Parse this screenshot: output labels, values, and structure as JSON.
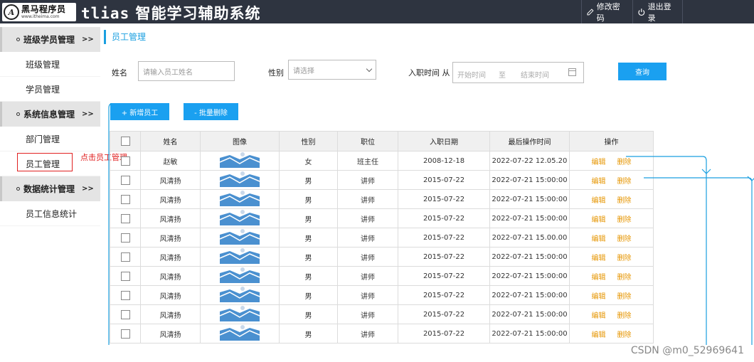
{
  "header": {
    "logo_cn": "黑马程序员",
    "logo_url": "www.itheima.com",
    "title_latin": "tlias",
    "title_cn": "智能学习辅助系统",
    "change_password": "修改密码",
    "logout": "退出登录"
  },
  "sidebar": {
    "groups": [
      {
        "label": "班级学员管理",
        "arrow": ">>",
        "items": [
          "班级管理",
          "学员管理"
        ]
      },
      {
        "label": "系统信息管理",
        "arrow": ">>",
        "items": [
          "部门管理",
          "员工管理"
        ]
      },
      {
        "label": "数据统计管理",
        "arrow": ">>",
        "items": [
          "员工信息统计"
        ]
      }
    ],
    "active_item": "员工管理"
  },
  "annotation": {
    "click_hint": "点击员工管理"
  },
  "page_title": "员工管理",
  "search": {
    "name_label": "姓名",
    "name_placeholder": "请输入员工姓名",
    "gender_label": "性别",
    "gender_placeholder": "请选择",
    "date_label": "入职时间 从",
    "date_start_placeholder": "开始时间",
    "date_sep": "至",
    "date_end_placeholder": "结束时间",
    "query_button": "查询"
  },
  "actions": {
    "add_button": "+ 新增员工",
    "batch_delete_button": "- 批量删除"
  },
  "table": {
    "columns": [
      "姓名",
      "图像",
      "性别",
      "职位",
      "入职日期",
      "最后操作时间",
      "操作"
    ],
    "edit_label": "编辑",
    "delete_label": "删除",
    "rows": [
      {
        "name": "赵敏",
        "gender": "女",
        "position": "班主任",
        "entry_date": "2008-12-18",
        "last_op": "2022-07-22 12.05.20"
      },
      {
        "name": "风清扬",
        "gender": "男",
        "position": "讲师",
        "entry_date": "2015-07-22",
        "last_op": "2022-07-21 15:00:00"
      },
      {
        "name": "风清扬",
        "gender": "男",
        "position": "讲师",
        "entry_date": "2015-07-22",
        "last_op": "2022-07-21 15:00:00"
      },
      {
        "name": "风清扬",
        "gender": "男",
        "position": "讲师",
        "entry_date": "2015-07-22",
        "last_op": "2022-07-21 15:00:00"
      },
      {
        "name": "风清扬",
        "gender": "男",
        "position": "讲师",
        "entry_date": "2015-07-22",
        "last_op": "2022-07-21 15.00.00"
      },
      {
        "name": "风清扬",
        "gender": "男",
        "position": "讲师",
        "entry_date": "2015-07-22",
        "last_op": "2022-07-21 15:00:00"
      },
      {
        "name": "风清扬",
        "gender": "男",
        "position": "讲师",
        "entry_date": "2015-07-22",
        "last_op": "2022-07-21 15:00:00"
      },
      {
        "name": "风清扬",
        "gender": "男",
        "position": "讲师",
        "entry_date": "2015-07-22",
        "last_op": "2022-07-21 15:00:00"
      },
      {
        "name": "风清扬",
        "gender": "男",
        "position": "讲师",
        "entry_date": "2015-07-22",
        "last_op": "2022-07-21 15:00:00"
      },
      {
        "name": "风清扬",
        "gender": "男",
        "position": "讲师",
        "entry_date": "2015-07-22",
        "last_op": "2022-07-21 15:00:00"
      }
    ]
  },
  "watermark": "CSDN @m0_52969641",
  "colors": {
    "header_bg": "#2e3440",
    "accent": "#1aa0f0",
    "link": "#e69500",
    "annotation": "#e02020"
  }
}
